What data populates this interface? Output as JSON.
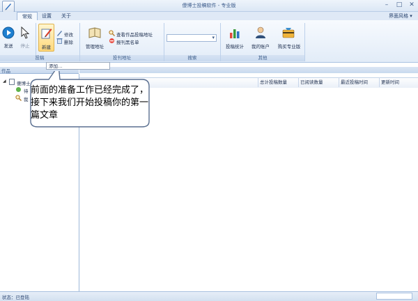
{
  "window": {
    "title": "傻博士投稿软件 - 专业版",
    "minimize": "–",
    "maximize": "□",
    "close": "✕"
  },
  "tabs": [
    {
      "label": "常规"
    },
    {
      "label": "设置"
    },
    {
      "label": "关于"
    }
  ],
  "skin_menu": "界面风格",
  "ribbon": {
    "groups": [
      "投稿",
      "投刊地址",
      "搜索",
      "其他"
    ],
    "send": "发送",
    "stop": "停止",
    "new": "新建",
    "edit": "修改",
    "delete": "删除",
    "manage_address": "管理地址",
    "view_address": "查看作品投稿地址",
    "blacklist": "报刊黑名单",
    "search_select_value": "",
    "stats": "投稿统计",
    "account": "我的账户",
    "buy": "购买专业版"
  },
  "tooltip": "添加…",
  "left_panel": {
    "header": "作品",
    "tree": [
      {
        "label": "傻博士"
      },
      {
        "label": "待"
      },
      {
        "label": "我"
      }
    ]
  },
  "grid": {
    "columns": [
      "总计投稿数量",
      "已阅读数量",
      "最近投稿时间",
      "更新时间"
    ]
  },
  "callout": {
    "text": "前面的准备工作已经完成了，接下来我们开始投稿你的第一篇文章"
  },
  "status": {
    "text": "状态：已登陆"
  },
  "colors": {
    "accent": "#1e7fd0",
    "ribbon_bg": "#e2ecf8",
    "callout_border": "#5a6f90"
  }
}
